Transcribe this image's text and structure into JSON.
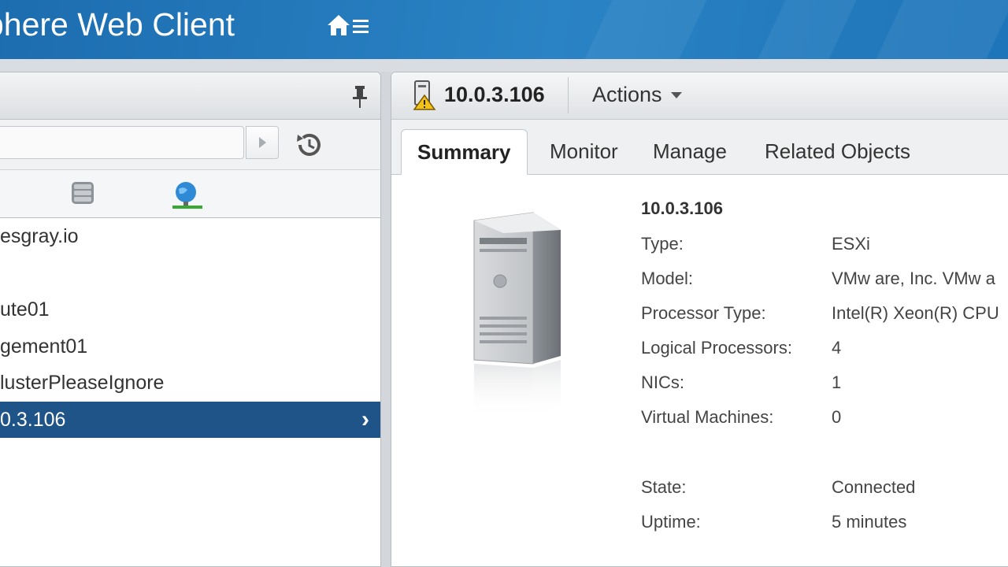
{
  "header": {
    "app_title": "phere Web Client",
    "home_icon": "home-icon",
    "menu_icon": "menu-icon"
  },
  "navigator": {
    "pin_icon": "pin-icon",
    "search": {
      "value": ""
    },
    "history_icon": "history-icon",
    "view_icons": [
      "storage-icon",
      "network-icon"
    ],
    "tree_items": [
      {
        "label": "esgray.io",
        "selected": false
      },
      {
        "label": "",
        "selected": false
      },
      {
        "label": "ute01",
        "selected": false
      },
      {
        "label": "gement01",
        "selected": false
      },
      {
        "label": "lusterPleaseIgnore",
        "selected": false
      },
      {
        "label": "0.3.106",
        "selected": true
      }
    ]
  },
  "object": {
    "title": "10.0.3.106",
    "actions_label": "Actions",
    "tabs": [
      "Summary",
      "Monitor",
      "Manage",
      "Related Objects"
    ],
    "active_tab": "Summary"
  },
  "summary": {
    "host_name": "10.0.3.106",
    "rows": [
      {
        "label": "Type:",
        "value": "ESXi"
      },
      {
        "label": "Model:",
        "value": "VMw are, Inc. VMw a"
      },
      {
        "label": "Processor Type:",
        "value": "Intel(R) Xeon(R) CPU"
      },
      {
        "label": "Logical Processors:",
        "value": "4"
      },
      {
        "label": "NICs:",
        "value": "1"
      },
      {
        "label": "Virtual Machines:",
        "value": "0"
      },
      {
        "label": "State:",
        "value": "Connected"
      },
      {
        "label": "Uptime:",
        "value": "5 minutes"
      }
    ]
  },
  "colors": {
    "header_blue": "#1c6db0",
    "selection": "#1f5488"
  }
}
